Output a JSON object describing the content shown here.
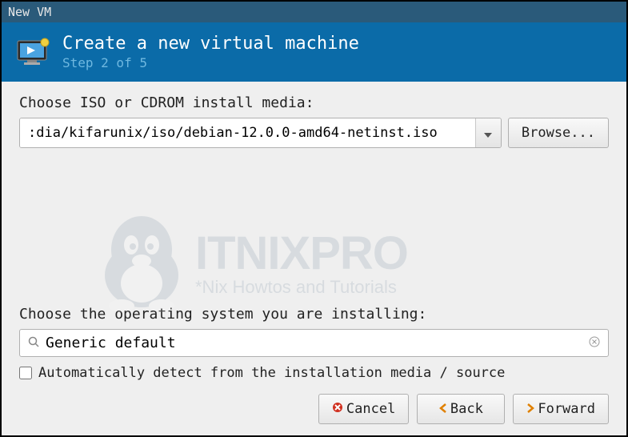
{
  "window": {
    "title": "New VM"
  },
  "header": {
    "title": "Create a new virtual machine",
    "step": "Step 2 of 5"
  },
  "iso": {
    "label": "Choose ISO or CDROM install media:",
    "path": ":dia/kifarunix/iso/debian-12.0.0-amd64-netinst.iso",
    "browse": "Browse..."
  },
  "watermark": {
    "title": "ITNIXPRO",
    "sub": "*Nix Howtos and Tutorials"
  },
  "os": {
    "label": "Choose the operating system you are installing:",
    "value": "Generic default",
    "autodetect_label": "Automatically detect from the installation media / source",
    "autodetect_checked": false
  },
  "footer": {
    "cancel": "Cancel",
    "back": "Back",
    "forward": "Forward"
  }
}
